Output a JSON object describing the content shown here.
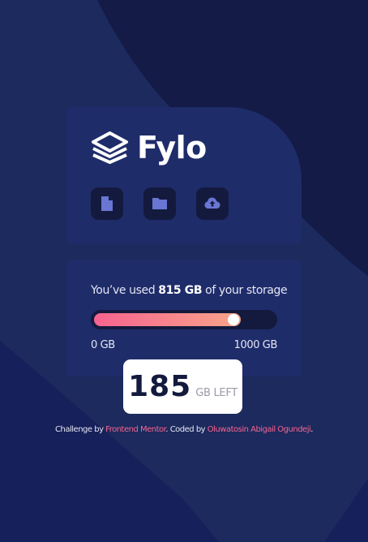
{
  "logo": {
    "text": "Fylo"
  },
  "tools": [
    {
      "name": "document-icon"
    },
    {
      "name": "folder-icon"
    },
    {
      "name": "upload-icon"
    }
  ],
  "usage": {
    "prefix": "You’ve used ",
    "amount": "815 GB",
    "suffix": " of your storage",
    "used_fraction": 0.815,
    "scale_min": "0 GB",
    "scale_max": "1000 GB"
  },
  "remaining": {
    "number": "185",
    "unit": "GB LEFT"
  },
  "attribution": {
    "prefix": "Challenge by ",
    "mentor": "Frontend Mentor",
    "middle": ". Coded by ",
    "author": "Oluwatosin Abigail Ogundeji",
    "suffix": "."
  },
  "colors": {
    "background": "#1c2a5e",
    "card": "#1f2c6a",
    "tool_bg": "#141a3e",
    "gradient_start": "#f6638f",
    "gradient_end": "#f8a58a",
    "icon": "#6976d3"
  }
}
